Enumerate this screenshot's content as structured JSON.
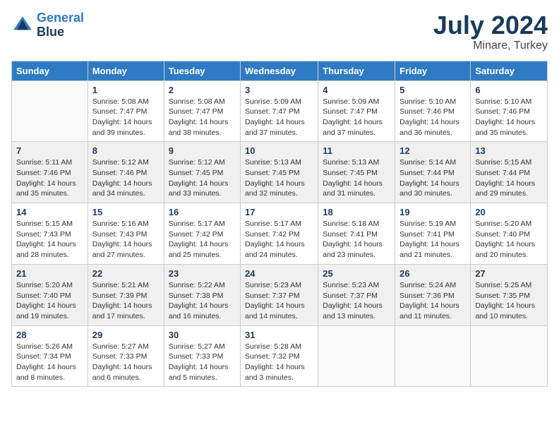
{
  "header": {
    "logo_line1": "General",
    "logo_line2": "Blue",
    "month": "July 2024",
    "location": "Minare, Turkey"
  },
  "days_of_week": [
    "Sunday",
    "Monday",
    "Tuesday",
    "Wednesday",
    "Thursday",
    "Friday",
    "Saturday"
  ],
  "weeks": [
    [
      {
        "day": "",
        "info": ""
      },
      {
        "day": "1",
        "info": "Sunrise: 5:08 AM\nSunset: 7:47 PM\nDaylight: 14 hours\nand 39 minutes."
      },
      {
        "day": "2",
        "info": "Sunrise: 5:08 AM\nSunset: 7:47 PM\nDaylight: 14 hours\nand 38 minutes."
      },
      {
        "day": "3",
        "info": "Sunrise: 5:09 AM\nSunset: 7:47 PM\nDaylight: 14 hours\nand 37 minutes."
      },
      {
        "day": "4",
        "info": "Sunrise: 5:09 AM\nSunset: 7:47 PM\nDaylight: 14 hours\nand 37 minutes."
      },
      {
        "day": "5",
        "info": "Sunrise: 5:10 AM\nSunset: 7:46 PM\nDaylight: 14 hours\nand 36 minutes."
      },
      {
        "day": "6",
        "info": "Sunrise: 5:10 AM\nSunset: 7:46 PM\nDaylight: 14 hours\nand 35 minutes."
      }
    ],
    [
      {
        "day": "7",
        "info": "Sunrise: 5:11 AM\nSunset: 7:46 PM\nDaylight: 14 hours\nand 35 minutes."
      },
      {
        "day": "8",
        "info": "Sunrise: 5:12 AM\nSunset: 7:46 PM\nDaylight: 14 hours\nand 34 minutes."
      },
      {
        "day": "9",
        "info": "Sunrise: 5:12 AM\nSunset: 7:45 PM\nDaylight: 14 hours\nand 33 minutes."
      },
      {
        "day": "10",
        "info": "Sunrise: 5:13 AM\nSunset: 7:45 PM\nDaylight: 14 hours\nand 32 minutes."
      },
      {
        "day": "11",
        "info": "Sunrise: 5:13 AM\nSunset: 7:45 PM\nDaylight: 14 hours\nand 31 minutes."
      },
      {
        "day": "12",
        "info": "Sunrise: 5:14 AM\nSunset: 7:44 PM\nDaylight: 14 hours\nand 30 minutes."
      },
      {
        "day": "13",
        "info": "Sunrise: 5:15 AM\nSunset: 7:44 PM\nDaylight: 14 hours\nand 29 minutes."
      }
    ],
    [
      {
        "day": "14",
        "info": "Sunrise: 5:15 AM\nSunset: 7:43 PM\nDaylight: 14 hours\nand 28 minutes."
      },
      {
        "day": "15",
        "info": "Sunrise: 5:16 AM\nSunset: 7:43 PM\nDaylight: 14 hours\nand 27 minutes."
      },
      {
        "day": "16",
        "info": "Sunrise: 5:17 AM\nSunset: 7:42 PM\nDaylight: 14 hours\nand 25 minutes."
      },
      {
        "day": "17",
        "info": "Sunrise: 5:17 AM\nSunset: 7:42 PM\nDaylight: 14 hours\nand 24 minutes."
      },
      {
        "day": "18",
        "info": "Sunrise: 5:18 AM\nSunset: 7:41 PM\nDaylight: 14 hours\nand 23 minutes."
      },
      {
        "day": "19",
        "info": "Sunrise: 5:19 AM\nSunset: 7:41 PM\nDaylight: 14 hours\nand 21 minutes."
      },
      {
        "day": "20",
        "info": "Sunrise: 5:20 AM\nSunset: 7:40 PM\nDaylight: 14 hours\nand 20 minutes."
      }
    ],
    [
      {
        "day": "21",
        "info": "Sunrise: 5:20 AM\nSunset: 7:40 PM\nDaylight: 14 hours\nand 19 minutes."
      },
      {
        "day": "22",
        "info": "Sunrise: 5:21 AM\nSunset: 7:39 PM\nDaylight: 14 hours\nand 17 minutes."
      },
      {
        "day": "23",
        "info": "Sunrise: 5:22 AM\nSunset: 7:38 PM\nDaylight: 14 hours\nand 16 minutes."
      },
      {
        "day": "24",
        "info": "Sunrise: 5:23 AM\nSunset: 7:37 PM\nDaylight: 14 hours\nand 14 minutes."
      },
      {
        "day": "25",
        "info": "Sunrise: 5:23 AM\nSunset: 7:37 PM\nDaylight: 14 hours\nand 13 minutes."
      },
      {
        "day": "26",
        "info": "Sunrise: 5:24 AM\nSunset: 7:36 PM\nDaylight: 14 hours\nand 11 minutes."
      },
      {
        "day": "27",
        "info": "Sunrise: 5:25 AM\nSunset: 7:35 PM\nDaylight: 14 hours\nand 10 minutes."
      }
    ],
    [
      {
        "day": "28",
        "info": "Sunrise: 5:26 AM\nSunset: 7:34 PM\nDaylight: 14 hours\nand 8 minutes."
      },
      {
        "day": "29",
        "info": "Sunrise: 5:27 AM\nSunset: 7:33 PM\nDaylight: 14 hours\nand 6 minutes."
      },
      {
        "day": "30",
        "info": "Sunrise: 5:27 AM\nSunset: 7:33 PM\nDaylight: 14 hours\nand 5 minutes."
      },
      {
        "day": "31",
        "info": "Sunrise: 5:28 AM\nSunset: 7:32 PM\nDaylight: 14 hours\nand 3 minutes."
      },
      {
        "day": "",
        "info": ""
      },
      {
        "day": "",
        "info": ""
      },
      {
        "day": "",
        "info": ""
      }
    ]
  ]
}
